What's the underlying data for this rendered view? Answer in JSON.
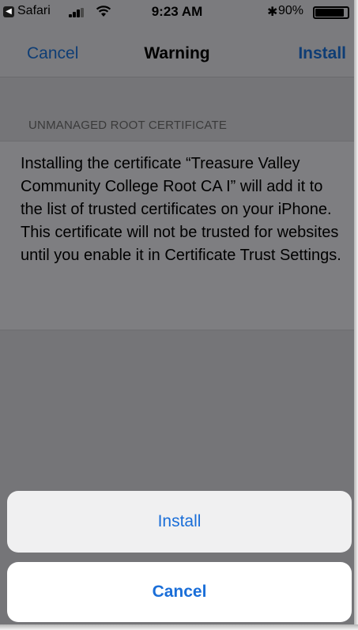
{
  "status_bar": {
    "back_glyph": "◀",
    "app": "Safari",
    "time": "9:23 AM",
    "bluetooth_glyph": "✱",
    "battery_percent": "90%",
    "battery_level": 0.9
  },
  "nav_bar": {
    "left_button": "Cancel",
    "title": "Warning",
    "right_button": "Install"
  },
  "section": {
    "header": "UNMANAGED ROOT CERTIFICATE",
    "message": "Installing the certificate “Treasure Valley Community College Root CA I” will add it to the list of trusted certificates on your iPhone. This certificate will not be trusted for websites until you enable it in Certificate Trust Settings."
  },
  "action_sheet": {
    "install_label": "Install",
    "cancel_label": "Cancel"
  },
  "colors": {
    "link_blue": "#1a6ed8",
    "dimmed_link": "#0e3d75",
    "overlay_gray": "#757578"
  }
}
